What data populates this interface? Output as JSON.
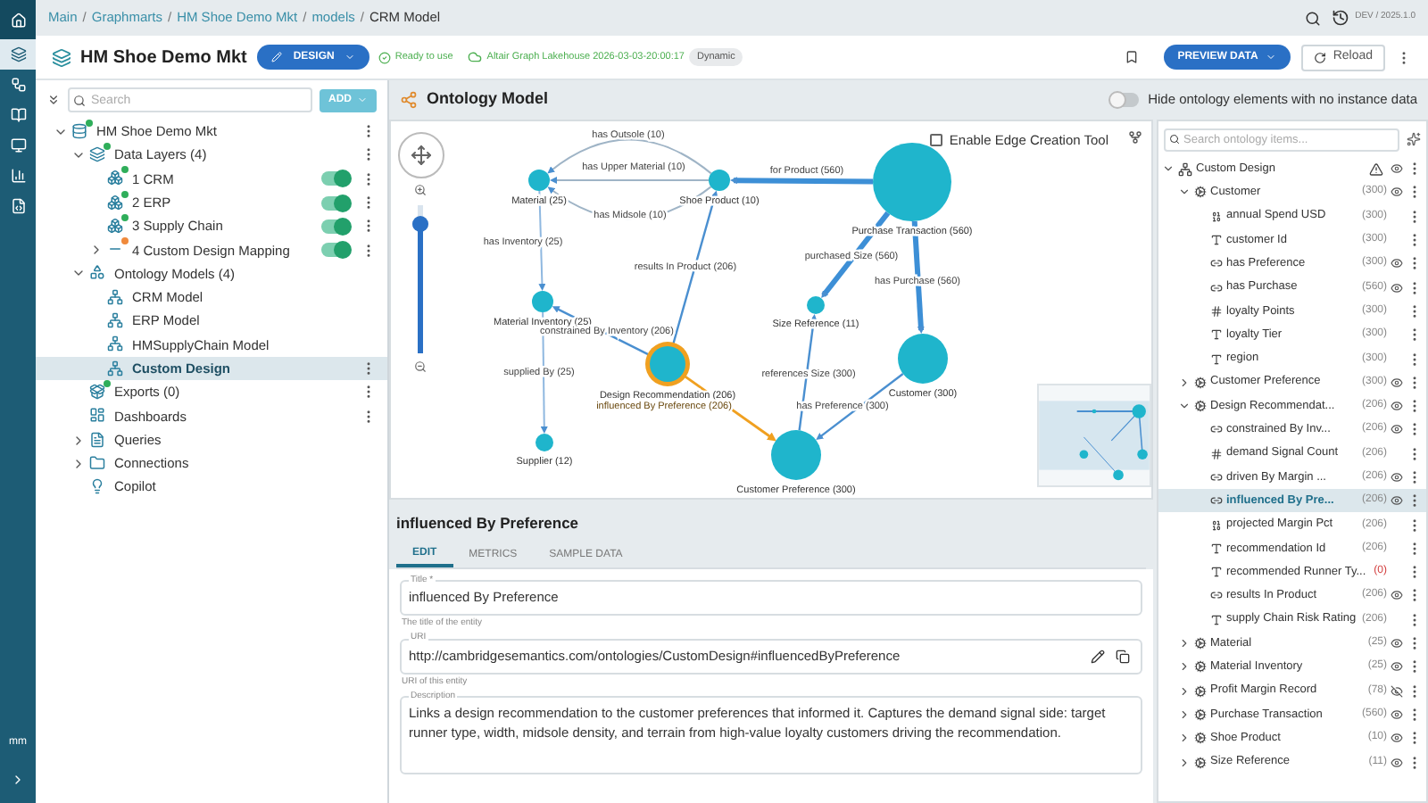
{
  "rail": {
    "items": [
      {
        "selected": false
      },
      {
        "selected": true
      },
      {
        "selected": false
      },
      {
        "selected": false
      },
      {
        "selected": false
      },
      {
        "selected": false
      },
      {
        "selected": false
      }
    ],
    "user": "mm"
  },
  "breadcrumb": {
    "separator": "/",
    "crumbs": [
      "Main",
      "Graphmarts",
      "HM Shoe Demo Mkt",
      "models",
      "CRM Model"
    ]
  },
  "version": "DEV / 2025.1.0",
  "header": {
    "title": "HM Shoe Demo Mkt",
    "mode_button": "DESIGN",
    "status": "Ready to use",
    "source": "Altair Graph Lakehouse 2026-03-03-20:00:17",
    "badge": "Dynamic",
    "preview_button": "PREVIEW DATA",
    "reload_button": "Reload"
  },
  "left": {
    "search": {
      "placeholder": "Search"
    },
    "add_button": "ADD",
    "root": {
      "label": "HM Shoe Demo Mkt",
      "kind": "graphmart",
      "color": "#2fae5a",
      "expanded": true,
      "selected": false,
      "menu": true,
      "children": [
        {
          "label": "Data Layers (4)",
          "kind": "layers",
          "color": "#2fae5a",
          "expanded": true,
          "selected": false,
          "menu": true,
          "children": [
            {
              "label": "1 CRM",
              "kind": "layer",
              "color": "#2fae5a",
              "on": true,
              "selected": false,
              "menu": true
            },
            {
              "label": "2 ERP",
              "kind": "layer",
              "color": "#2fae5a",
              "on": true,
              "selected": false,
              "menu": true
            },
            {
              "label": "3 Supply Chain",
              "kind": "layer",
              "color": "#2fae5a",
              "on": true,
              "selected": false,
              "menu": true
            },
            {
              "label": "4 Custom Design Mapping",
              "kind": "mapping",
              "color": "#f08a3c",
              "on": true,
              "expanded": false,
              "selected": false,
              "menu": true
            }
          ]
        },
        {
          "label": "Ontology Models (4)",
          "kind": "ontologies",
          "expanded": true,
          "selected": false,
          "menu": false,
          "children": [
            {
              "label": "CRM Model",
              "kind": "model",
              "selected": false,
              "menu": false
            },
            {
              "label": "ERP Model",
              "kind": "model",
              "selected": false,
              "menu": false
            },
            {
              "label": "HMSupplyChain Model",
              "kind": "model",
              "selected": false,
              "menu": false
            },
            {
              "label": "Custom Design",
              "kind": "model",
              "selected": true,
              "menu": true
            }
          ]
        },
        {
          "label": "Exports (0)",
          "kind": "exports",
          "color": "#2fae5a",
          "selected": false,
          "menu": true
        },
        {
          "label": "Dashboards",
          "kind": "dashboards",
          "selected": false,
          "menu": true
        },
        {
          "label": "Queries",
          "kind": "queries",
          "expanded": false,
          "selected": false,
          "menu": false
        },
        {
          "label": "Connections",
          "kind": "connections",
          "expanded": false,
          "selected": false,
          "menu": false
        },
        {
          "label": "Copilot",
          "kind": "copilot",
          "selected": false,
          "menu": false
        }
      ]
    }
  },
  "graph": {
    "title": "Ontology Model",
    "hide_toggle": {
      "label": "Hide ontology elements with no instance data",
      "on": false
    },
    "edge_tool": {
      "label": "Enable Edge Creation Tool",
      "checked": false
    },
    "zoom": {
      "level": 0.87
    },
    "nodes": [
      {
        "label": "Material (25)",
        "selected": false
      },
      {
        "label": "Shoe Product (10)",
        "selected": false
      },
      {
        "label": "Purchase Transaction (560)",
        "selected": false
      },
      {
        "label": "Material Inventory (25)",
        "selected": false
      },
      {
        "label": "Size Reference (11)",
        "selected": false
      },
      {
        "label": "Design Recommendation (206)",
        "selected": true
      },
      {
        "label": "Customer (300)",
        "selected": false
      },
      {
        "label": "Customer Preference (300)",
        "selected": false
      },
      {
        "label": "Supplier (12)",
        "selected": false
      }
    ],
    "edges": [
      {
        "label": "has Outsole (10)",
        "kind": "faint",
        "selected": false
      },
      {
        "label": "has Upper Material (10)",
        "kind": "faint",
        "selected": false
      },
      {
        "label": "has Midsole (10)",
        "kind": "faint",
        "selected": false
      },
      {
        "label": "for Product (560)",
        "kind": "heavy",
        "selected": false
      },
      {
        "label": "has Inventory (25)",
        "kind": "light",
        "selected": false
      },
      {
        "label": "results In Product (206)",
        "kind": "normal",
        "selected": false
      },
      {
        "label": "purchased Size (560)",
        "kind": "heavy",
        "selected": false
      },
      {
        "label": "has Purchase (560)",
        "kind": "heavy",
        "selected": false
      },
      {
        "label": "constrained By Inventory (206)",
        "kind": "normal",
        "selected": false
      },
      {
        "label": "references Size (300)",
        "kind": "normal",
        "selected": false
      },
      {
        "label": "influenced By Preference (206)",
        "kind": "normal",
        "selected": true
      },
      {
        "label": "has Preference (300)",
        "kind": "normal",
        "selected": false
      },
      {
        "label": "supplied By (25)",
        "kind": "light",
        "selected": false
      }
    ]
  },
  "details": {
    "title": "influenced By Preference",
    "tabs": [
      {
        "label": "EDIT",
        "selected": true
      },
      {
        "label": "METRICS",
        "selected": false
      },
      {
        "label": "SAMPLE DATA",
        "selected": false
      }
    ],
    "fields": [
      {
        "kind": "text",
        "label": "Title *",
        "value": "influenced By Preference",
        "helper": "The title of the entity"
      },
      {
        "kind": "uri",
        "label": "URI",
        "value": "http://cambridgesemantics.com/ontologies/CustomDesign#influencedByPreference",
        "helper": "URI of this entity"
      },
      {
        "kind": "multiline",
        "label": "Description",
        "value": "Links a design recommendation to the customer preferences that informed it. Captures the demand signal side: target runner type, width, midsole density, and terrain from high-value loyalty customers driving the recommendation."
      }
    ]
  },
  "ontology": {
    "search": {
      "placeholder": "Search ontology items..."
    },
    "root": {
      "label": "Custom Design",
      "warning": true,
      "visible": true,
      "expanded": true,
      "children": [
        {
          "label": "Customer",
          "count": "(300)",
          "kind": "class",
          "visible": true,
          "expanded": true,
          "selected": false,
          "alert": false,
          "children": [
            {
              "label": "annual Spend USD",
              "count": "(300)",
              "kind": "decimal",
              "selected": false,
              "alert": false
            },
            {
              "label": "customer Id",
              "count": "(300)",
              "kind": "text",
              "selected": false,
              "alert": false
            },
            {
              "label": "has Preference",
              "count": "(300)",
              "kind": "link",
              "visible": true,
              "selected": false,
              "alert": false
            },
            {
              "label": "has Purchase",
              "count": "(560)",
              "kind": "link",
              "visible": true,
              "selected": false,
              "alert": false
            },
            {
              "label": "loyalty Points",
              "count": "(300)",
              "kind": "integer",
              "selected": false,
              "alert": false
            },
            {
              "label": "loyalty Tier",
              "count": "(300)",
              "kind": "text",
              "selected": false,
              "alert": false
            },
            {
              "label": "region",
              "count": "(300)",
              "kind": "text",
              "selected": false,
              "alert": false
            }
          ]
        },
        {
          "label": "Customer Preference",
          "count": "(300)",
          "kind": "class",
          "visible": true,
          "expanded": false,
          "selected": false,
          "alert": false
        },
        {
          "label": "Design Recommendat...",
          "count": "(206)",
          "kind": "class",
          "visible": true,
          "expanded": true,
          "selected": false,
          "alert": false,
          "children": [
            {
              "label": "constrained By Inv...",
              "count": "(206)",
              "kind": "link",
              "visible": true,
              "selected": false,
              "alert": false
            },
            {
              "label": "demand Signal Count",
              "count": "(206)",
              "kind": "integer",
              "selected": false,
              "alert": false
            },
            {
              "label": "driven By Margin ...",
              "count": "(206)",
              "kind": "link",
              "visible": true,
              "selected": false,
              "alert": false
            },
            {
              "label": "influenced By Pre...",
              "count": "(206)",
              "kind": "link",
              "visible": true,
              "selected": true,
              "alert": false
            },
            {
              "label": "projected Margin Pct",
              "count": "(206)",
              "kind": "decimal",
              "selected": false,
              "alert": false
            },
            {
              "label": "recommendation Id",
              "count": "(206)",
              "kind": "text",
              "selected": false,
              "alert": false
            },
            {
              "label": "recommended Runner Ty...",
              "count": "(0)",
              "kind": "text",
              "selected": false,
              "alert": true
            },
            {
              "label": "results In Product",
              "count": "(206)",
              "kind": "link",
              "visible": true,
              "selected": false,
              "alert": false
            },
            {
              "label": "supply Chain Risk Rating",
              "count": "(206)",
              "kind": "text",
              "selected": false,
              "alert": false
            }
          ]
        },
        {
          "label": "Material",
          "count": "(25)",
          "kind": "class",
          "visible": true,
          "expanded": false,
          "selected": false,
          "alert": false
        },
        {
          "label": "Material Inventory",
          "count": "(25)",
          "kind": "class",
          "visible": true,
          "expanded": false,
          "selected": false,
          "alert": false
        },
        {
          "label": "Profit Margin Record",
          "count": "(78)",
          "kind": "class",
          "visible": false,
          "expanded": false,
          "selected": false,
          "alert": false
        },
        {
          "label": "Purchase Transaction",
          "count": "(560)",
          "kind": "class",
          "visible": true,
          "expanded": false,
          "selected": false,
          "alert": false
        },
        {
          "label": "Shoe Product",
          "count": "(10)",
          "kind": "class",
          "visible": true,
          "expanded": false,
          "selected": false,
          "alert": false
        },
        {
          "label": "Size Reference",
          "count": "(11)",
          "kind": "class",
          "visible": true,
          "expanded": false,
          "selected": false,
          "alert": false
        }
      ]
    }
  }
}
